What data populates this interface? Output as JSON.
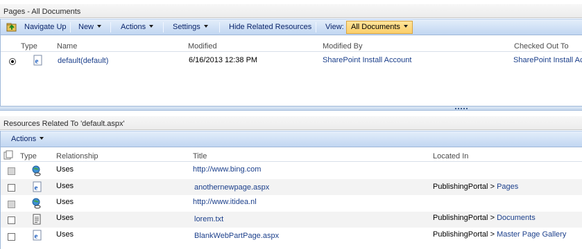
{
  "pages_panel": {
    "title": "Pages - All Documents",
    "toolbar": {
      "navigate_up": "Navigate Up",
      "new": "New",
      "actions": "Actions",
      "settings": "Settings",
      "hide_related": "Hide Related Resources",
      "view_label": "View:",
      "view_value": "All Documents"
    },
    "columns": [
      "Type",
      "Name",
      "Modified",
      "Modified By",
      "Checked Out To"
    ],
    "rows": [
      {
        "name": "default(default)",
        "modified": "6/16/2013 12:38 PM",
        "modified_by": "SharePoint Install Account",
        "checked_out_to": "SharePoint Install Account"
      }
    ]
  },
  "related_panel": {
    "title": "Resources Related To 'default.aspx'",
    "toolbar": {
      "actions": "Actions"
    },
    "columns": [
      "Type",
      "Relationship",
      "Title",
      "Located In"
    ],
    "rows": [
      {
        "type_icon": "globe-link-icon",
        "relationship": "Uses",
        "title": "http://www.bing.com",
        "site": "",
        "sep": "",
        "library": ""
      },
      {
        "type_icon": "ie-page-icon",
        "relationship": "Uses",
        "title": "anothernewpage.aspx",
        "site": "PublishingPortal",
        "sep": ">",
        "library": "Pages"
      },
      {
        "type_icon": "globe-link-icon",
        "relationship": "Uses",
        "title": "http://www.itidea.nl",
        "site": "",
        "sep": "",
        "library": ""
      },
      {
        "type_icon": "text-file-icon",
        "relationship": "Uses",
        "title": "lorem.txt",
        "site": "PublishingPortal",
        "sep": ">",
        "library": "Documents"
      },
      {
        "type_icon": "ie-page-icon",
        "relationship": "Uses",
        "title": "BlankWebPartPage.aspx",
        "site": "PublishingPortal",
        "sep": ">",
        "library": "Master Page Gallery"
      }
    ]
  },
  "colors": {
    "link": "#1b3f8b",
    "toolbar": "#d2e2f6",
    "view_dropdown": "#fbcf6b"
  }
}
